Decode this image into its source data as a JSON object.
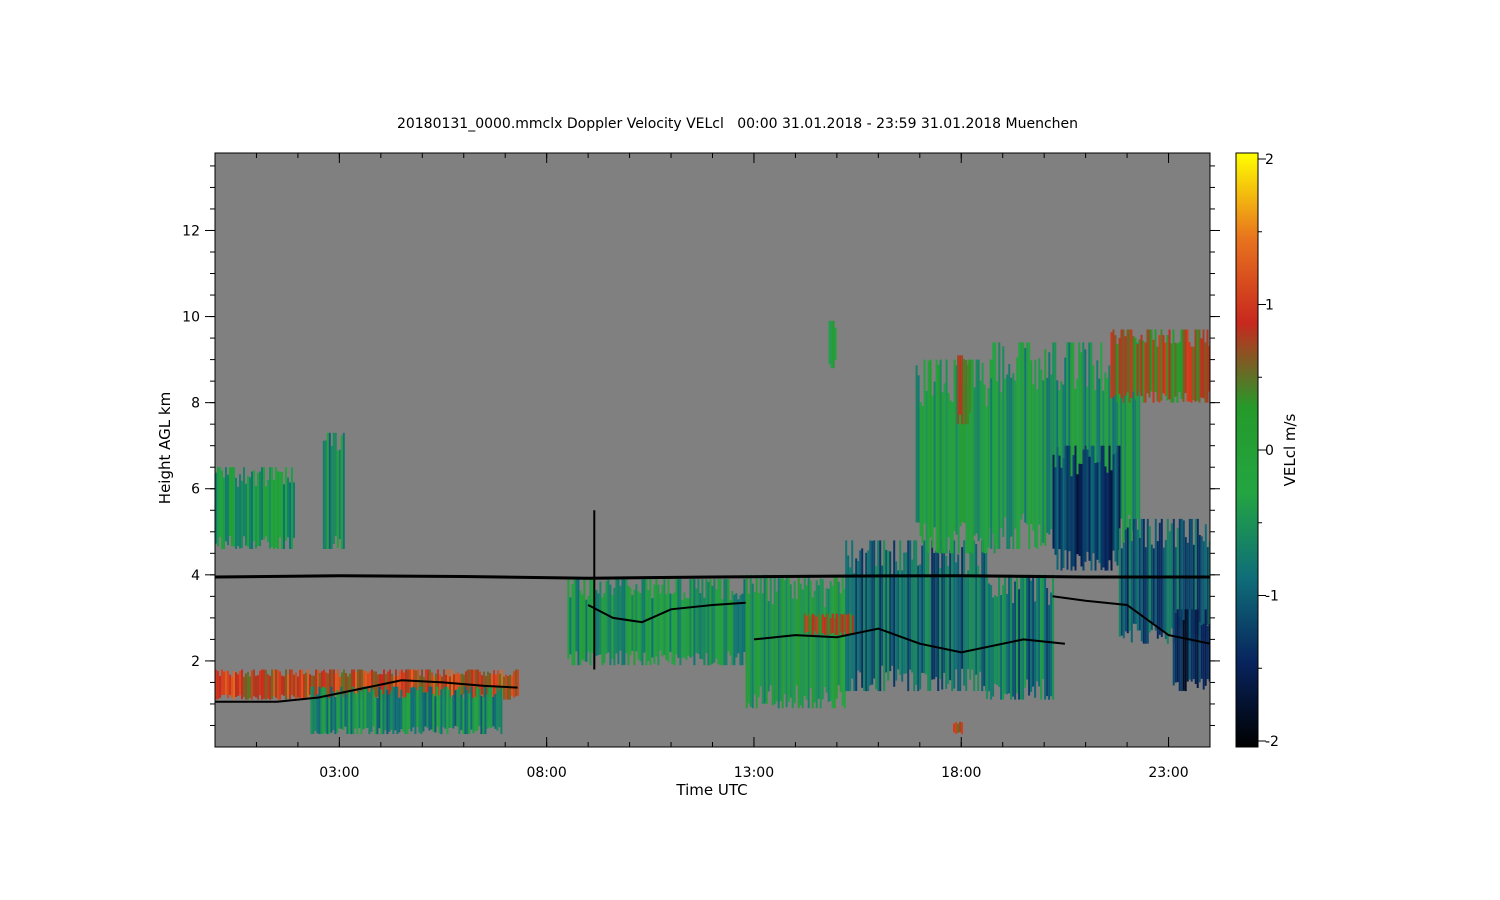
{
  "chart_data": {
    "type": "heatmap",
    "title": "20180131_0000.mmclx Doppler Velocity VELcl   00:00 31.01.2018 - 23:59 31.01.2018 Muenchen",
    "xlabel": "Time UTC",
    "ylabel": "Height AGL km",
    "colorbar_label": "VELcl m/s",
    "xlim": [
      0,
      24
    ],
    "ylim": [
      0,
      13.8
    ],
    "clim": [
      -2,
      2
    ],
    "x_ticks": [
      {
        "value": 3,
        "label": "03:00"
      },
      {
        "value": 8,
        "label": "08:00"
      },
      {
        "value": 13,
        "label": "13:00"
      },
      {
        "value": 18,
        "label": "18:00"
      },
      {
        "value": 23,
        "label": "23:00"
      }
    ],
    "y_ticks": [
      {
        "value": 2,
        "label": "2"
      },
      {
        "value": 4,
        "label": "4"
      },
      {
        "value": 6,
        "label": "6"
      },
      {
        "value": 8,
        "label": "8"
      },
      {
        "value": 10,
        "label": "10"
      },
      {
        "value": 12,
        "label": "12"
      }
    ],
    "colorbar_ticks": [
      {
        "value": 2,
        "label": "2"
      },
      {
        "value": 1,
        "label": "1"
      },
      {
        "value": 0,
        "label": "0"
      },
      {
        "value": -1,
        "label": "-1"
      },
      {
        "value": -2,
        "label": "-2"
      }
    ],
    "background_color": "#808080",
    "colormap": [
      "#000000",
      "#08245e",
      "#0f6e78",
      "#23a542",
      "#259a2a",
      "#c8281e",
      "#e8741e",
      "#ffff00"
    ],
    "regions": [
      {
        "t0": 0.0,
        "t1": 1.9,
        "h0": 4.6,
        "h1": 6.5,
        "vel": -0.4
      },
      {
        "t0": 2.6,
        "t1": 3.1,
        "h0": 4.6,
        "h1": 7.3,
        "vel": -0.5
      },
      {
        "t0": 0.0,
        "t1": 7.3,
        "h0": 1.1,
        "h1": 1.8,
        "vel": 0.9
      },
      {
        "t0": 2.3,
        "t1": 6.9,
        "h0": 0.3,
        "h1": 1.4,
        "vel": -0.6
      },
      {
        "t0": 8.5,
        "t1": 12.8,
        "h0": 1.9,
        "h1": 3.9,
        "vel": -0.4
      },
      {
        "t0": 12.8,
        "t1": 15.2,
        "h0": 0.9,
        "h1": 4.0,
        "vel": -0.3
      },
      {
        "t0": 14.8,
        "t1": 14.95,
        "h0": 8.8,
        "h1": 9.9,
        "vel": -0.2
      },
      {
        "t0": 15.2,
        "t1": 18.6,
        "h0": 1.3,
        "h1": 4.8,
        "vel": -0.9
      },
      {
        "t0": 16.9,
        "t1": 18.8,
        "h0": 4.5,
        "h1": 9.0,
        "vel": -0.3
      },
      {
        "t0": 17.9,
        "t1": 18.2,
        "h0": 7.5,
        "h1": 9.1,
        "vel": 0.7
      },
      {
        "t0": 18.6,
        "t1": 20.2,
        "h0": 1.1,
        "h1": 4.0,
        "vel": -0.8
      },
      {
        "t0": 18.7,
        "t1": 22.3,
        "h0": 4.6,
        "h1": 9.4,
        "vel": -0.4
      },
      {
        "t0": 20.2,
        "t1": 21.8,
        "h0": 4.1,
        "h1": 7.0,
        "vel": -1.3
      },
      {
        "t0": 21.8,
        "t1": 24.0,
        "h0": 2.4,
        "h1": 5.3,
        "vel": -1.0
      },
      {
        "t0": 21.6,
        "t1": 24.0,
        "h0": 8.0,
        "h1": 9.7,
        "vel": 0.6
      },
      {
        "t0": 23.1,
        "t1": 24.0,
        "h0": 1.3,
        "h1": 3.2,
        "vel": -1.4
      },
      {
        "t0": 14.2,
        "t1": 15.4,
        "h0": 2.6,
        "h1": 3.1,
        "vel": 0.7
      },
      {
        "t0": 17.8,
        "t1": 18.0,
        "h0": 0.3,
        "h1": 0.6,
        "vel": 0.8
      }
    ],
    "lines": [
      {
        "name": "",
        "points": [
          [
            0,
            3.95
          ],
          [
            3,
            3.98
          ],
          [
            6,
            3.96
          ],
          [
            9,
            3.92
          ],
          [
            12,
            3.95
          ],
          [
            15,
            3.97
          ],
          [
            18,
            3.98
          ],
          [
            21,
            3.95
          ],
          [
            24,
            3.95
          ]
        ]
      },
      {
        "name": "",
        "points": [
          [
            0,
            1.05
          ],
          [
            1.5,
            1.05
          ],
          [
            2.5,
            1.15
          ],
          [
            3.5,
            1.35
          ],
          [
            4.5,
            1.55
          ],
          [
            5.5,
            1.5
          ],
          [
            6.5,
            1.42
          ],
          [
            7.3,
            1.38
          ]
        ]
      },
      {
        "name": "",
        "points": [
          [
            9.0,
            3.3
          ],
          [
            9.6,
            3.0
          ],
          [
            10.3,
            2.9
          ],
          [
            11.0,
            3.2
          ],
          [
            12.0,
            3.3
          ],
          [
            12.8,
            3.35
          ]
        ]
      },
      {
        "name": "",
        "points": [
          [
            13.0,
            2.5
          ],
          [
            14.0,
            2.6
          ],
          [
            15.0,
            2.55
          ],
          [
            16.0,
            2.75
          ],
          [
            17.0,
            2.4
          ],
          [
            18.0,
            2.2
          ],
          [
            19.5,
            2.5
          ],
          [
            20.5,
            2.4
          ]
        ]
      },
      {
        "name": "",
        "points": [
          [
            20.2,
            3.5
          ],
          [
            21.0,
            3.4
          ],
          [
            22.0,
            3.3
          ],
          [
            23.0,
            2.6
          ],
          [
            24.0,
            2.4
          ]
        ]
      },
      {
        "name": "",
        "points": [
          [
            9.15,
            1.8
          ],
          [
            9.15,
            5.5
          ]
        ]
      }
    ]
  }
}
